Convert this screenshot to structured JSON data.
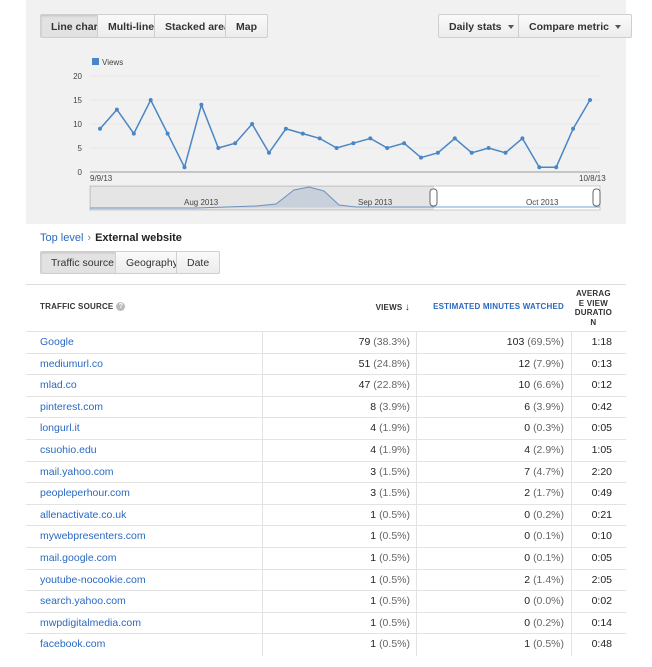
{
  "toolbar": {
    "chart_types": [
      "Line chart",
      "Multi-line",
      "Stacked area",
      "Map"
    ],
    "active_chart_type": "Line chart",
    "daily_stats_label": "Daily stats",
    "compare_metric_label": "Compare metric"
  },
  "colors": {
    "line": "#4a86c5",
    "link": "#2a69c2",
    "panel": "#f1f1f1"
  },
  "chart_data": {
    "type": "line",
    "legend": [
      "Views"
    ],
    "ylim": [
      0,
      20
    ],
    "yticks": [
      "0",
      "5",
      "10",
      "15",
      "20"
    ],
    "x_start_label": "9/9/13",
    "x_end_label": "10/8/13",
    "series": [
      {
        "name": "Views",
        "values": [
          9,
          13,
          8,
          15,
          8,
          1,
          14,
          5,
          6,
          10,
          4,
          9,
          8,
          7,
          5,
          6,
          7,
          5,
          6,
          3,
          4,
          7,
          4,
          5,
          4,
          7,
          1,
          1,
          9,
          15
        ]
      }
    ],
    "navigator_labels": [
      "Aug 2013",
      "Sep 2013",
      "Oct 2013"
    ]
  },
  "breadcrumb": {
    "parent": "Top level",
    "separator": "›",
    "current": "External website"
  },
  "tabs": [
    "Traffic source",
    "Geography",
    "Date"
  ],
  "active_tab": "Traffic source",
  "table": {
    "headers": {
      "source": "TRAFFIC SOURCE",
      "views": "VIEWS",
      "minutes": "ESTIMATED MINUTES WATCHED",
      "duration_lines": [
        "AVERAG",
        "E VIEW",
        "DURATIO",
        "N"
      ]
    },
    "rows": [
      {
        "source": "Google",
        "views": "79",
        "views_pct": "(38.3%)",
        "minutes": "103",
        "minutes_pct": "(69.5%)",
        "duration": "1:18"
      },
      {
        "source": "mediumurl.co",
        "views": "51",
        "views_pct": "(24.8%)",
        "minutes": "12",
        "minutes_pct": "(7.9%)",
        "duration": "0:13"
      },
      {
        "source": "mlad.co",
        "views": "47",
        "views_pct": "(22.8%)",
        "minutes": "10",
        "minutes_pct": "(6.6%)",
        "duration": "0:12"
      },
      {
        "source": "pinterest.com",
        "views": "8",
        "views_pct": "(3.9%)",
        "minutes": "6",
        "minutes_pct": "(3.9%)",
        "duration": "0:42"
      },
      {
        "source": "longurl.it",
        "views": "4",
        "views_pct": "(1.9%)",
        "minutes": "0",
        "minutes_pct": "(0.3%)",
        "duration": "0:05"
      },
      {
        "source": "csuohio.edu",
        "views": "4",
        "views_pct": "(1.9%)",
        "minutes": "4",
        "minutes_pct": "(2.9%)",
        "duration": "1:05"
      },
      {
        "source": "mail.yahoo.com",
        "views": "3",
        "views_pct": "(1.5%)",
        "minutes": "7",
        "minutes_pct": "(4.7%)",
        "duration": "2:20"
      },
      {
        "source": "peopleperhour.com",
        "views": "3",
        "views_pct": "(1.5%)",
        "minutes": "2",
        "minutes_pct": "(1.7%)",
        "duration": "0:49"
      },
      {
        "source": "allenactivate.co.uk",
        "views": "1",
        "views_pct": "(0.5%)",
        "minutes": "0",
        "minutes_pct": "(0.2%)",
        "duration": "0:21"
      },
      {
        "source": "mywebpresenters.com",
        "views": "1",
        "views_pct": "(0.5%)",
        "minutes": "0",
        "minutes_pct": "(0.1%)",
        "duration": "0:10"
      },
      {
        "source": "mail.google.com",
        "views": "1",
        "views_pct": "(0.5%)",
        "minutes": "0",
        "minutes_pct": "(0.1%)",
        "duration": "0:05"
      },
      {
        "source": "youtube-nocookie.com",
        "views": "1",
        "views_pct": "(0.5%)",
        "minutes": "2",
        "minutes_pct": "(1.4%)",
        "duration": "2:05"
      },
      {
        "source": "search.yahoo.com",
        "views": "1",
        "views_pct": "(0.5%)",
        "minutes": "0",
        "minutes_pct": "(0.0%)",
        "duration": "0:02"
      },
      {
        "source": "mwpdigitalmedia.com",
        "views": "1",
        "views_pct": "(0.5%)",
        "minutes": "0",
        "minutes_pct": "(0.2%)",
        "duration": "0:14"
      },
      {
        "source": "facebook.com",
        "views": "1",
        "views_pct": "(0.5%)",
        "minutes": "1",
        "minutes_pct": "(0.5%)",
        "duration": "0:48"
      }
    ]
  }
}
